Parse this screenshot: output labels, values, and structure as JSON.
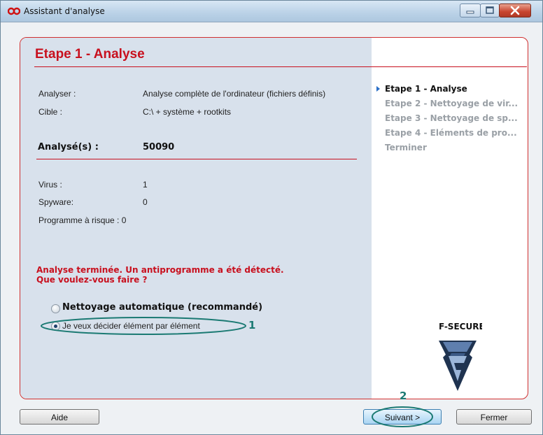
{
  "window": {
    "title": "Assistant d'analyse"
  },
  "main": {
    "heading": "Etape 1 - Analyse",
    "analyze_label": "Analyser :",
    "analyze_value": "Analyse complète de l'ordinateur (fichiers définis)",
    "target_label": "Cible :",
    "target_value": "C:\\  + système + rootkits",
    "scanned_label": "Analysé(s) :",
    "scanned_value": "50090",
    "virus_label": "Virus :",
    "virus_value": "1",
    "spyware_label": "Spyware:",
    "spyware_value": "0",
    "risk_label": "Programme à risque : 0",
    "message_line1": "Analyse terminée. Un antiprogramme a été détecté.",
    "message_line2": "Que voulez-vous faire ?",
    "option_auto": "Nettoyage automatique (recommandé)",
    "option_manual": "Je veux décider élément par élément",
    "selected_option": "manual"
  },
  "annotations": {
    "one": "1",
    "two": "2"
  },
  "steps": [
    {
      "label": "Etape 1 - Analyse",
      "current": true
    },
    {
      "label": "Etape 2 - Nettoyage de vir...",
      "current": false
    },
    {
      "label": "Etape 3 - Nettoyage de sp...",
      "current": false
    },
    {
      "label": "Etape 4 - Eléments de pro...",
      "current": false
    },
    {
      "label": "Terminer",
      "current": false
    }
  ],
  "brand": {
    "name": "F-SECURE"
  },
  "buttons": {
    "help": "Aide",
    "next": "Suivant >",
    "close": "Fermer"
  },
  "colors": {
    "accent_red": "#c8101e",
    "annotation_teal": "#1b7a73",
    "left_panel_bg": "#d8e1ec"
  }
}
